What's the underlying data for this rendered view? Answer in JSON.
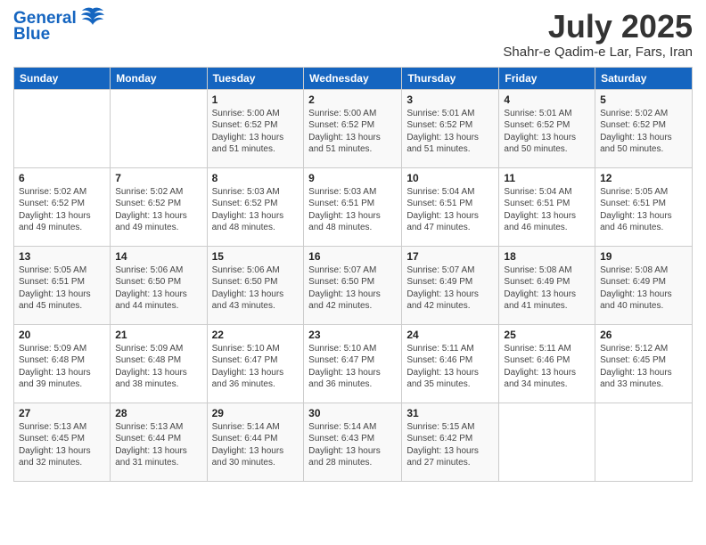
{
  "header": {
    "logo_line1": "General",
    "logo_line2": "Blue",
    "month": "July 2025",
    "location": "Shahr-e Qadim-e Lar, Fars, Iran"
  },
  "weekdays": [
    "Sunday",
    "Monday",
    "Tuesday",
    "Wednesday",
    "Thursday",
    "Friday",
    "Saturday"
  ],
  "weeks": [
    [
      {
        "day": "",
        "info": ""
      },
      {
        "day": "",
        "info": ""
      },
      {
        "day": "1",
        "info": "Sunrise: 5:00 AM\nSunset: 6:52 PM\nDaylight: 13 hours\nand 51 minutes."
      },
      {
        "day": "2",
        "info": "Sunrise: 5:00 AM\nSunset: 6:52 PM\nDaylight: 13 hours\nand 51 minutes."
      },
      {
        "day": "3",
        "info": "Sunrise: 5:01 AM\nSunset: 6:52 PM\nDaylight: 13 hours\nand 51 minutes."
      },
      {
        "day": "4",
        "info": "Sunrise: 5:01 AM\nSunset: 6:52 PM\nDaylight: 13 hours\nand 50 minutes."
      },
      {
        "day": "5",
        "info": "Sunrise: 5:02 AM\nSunset: 6:52 PM\nDaylight: 13 hours\nand 50 minutes."
      }
    ],
    [
      {
        "day": "6",
        "info": "Sunrise: 5:02 AM\nSunset: 6:52 PM\nDaylight: 13 hours\nand 49 minutes."
      },
      {
        "day": "7",
        "info": "Sunrise: 5:02 AM\nSunset: 6:52 PM\nDaylight: 13 hours\nand 49 minutes."
      },
      {
        "day": "8",
        "info": "Sunrise: 5:03 AM\nSunset: 6:52 PM\nDaylight: 13 hours\nand 48 minutes."
      },
      {
        "day": "9",
        "info": "Sunrise: 5:03 AM\nSunset: 6:51 PM\nDaylight: 13 hours\nand 48 minutes."
      },
      {
        "day": "10",
        "info": "Sunrise: 5:04 AM\nSunset: 6:51 PM\nDaylight: 13 hours\nand 47 minutes."
      },
      {
        "day": "11",
        "info": "Sunrise: 5:04 AM\nSunset: 6:51 PM\nDaylight: 13 hours\nand 46 minutes."
      },
      {
        "day": "12",
        "info": "Sunrise: 5:05 AM\nSunset: 6:51 PM\nDaylight: 13 hours\nand 46 minutes."
      }
    ],
    [
      {
        "day": "13",
        "info": "Sunrise: 5:05 AM\nSunset: 6:51 PM\nDaylight: 13 hours\nand 45 minutes."
      },
      {
        "day": "14",
        "info": "Sunrise: 5:06 AM\nSunset: 6:50 PM\nDaylight: 13 hours\nand 44 minutes."
      },
      {
        "day": "15",
        "info": "Sunrise: 5:06 AM\nSunset: 6:50 PM\nDaylight: 13 hours\nand 43 minutes."
      },
      {
        "day": "16",
        "info": "Sunrise: 5:07 AM\nSunset: 6:50 PM\nDaylight: 13 hours\nand 42 minutes."
      },
      {
        "day": "17",
        "info": "Sunrise: 5:07 AM\nSunset: 6:49 PM\nDaylight: 13 hours\nand 42 minutes."
      },
      {
        "day": "18",
        "info": "Sunrise: 5:08 AM\nSunset: 6:49 PM\nDaylight: 13 hours\nand 41 minutes."
      },
      {
        "day": "19",
        "info": "Sunrise: 5:08 AM\nSunset: 6:49 PM\nDaylight: 13 hours\nand 40 minutes."
      }
    ],
    [
      {
        "day": "20",
        "info": "Sunrise: 5:09 AM\nSunset: 6:48 PM\nDaylight: 13 hours\nand 39 minutes."
      },
      {
        "day": "21",
        "info": "Sunrise: 5:09 AM\nSunset: 6:48 PM\nDaylight: 13 hours\nand 38 minutes."
      },
      {
        "day": "22",
        "info": "Sunrise: 5:10 AM\nSunset: 6:47 PM\nDaylight: 13 hours\nand 36 minutes."
      },
      {
        "day": "23",
        "info": "Sunrise: 5:10 AM\nSunset: 6:47 PM\nDaylight: 13 hours\nand 36 minutes."
      },
      {
        "day": "24",
        "info": "Sunrise: 5:11 AM\nSunset: 6:46 PM\nDaylight: 13 hours\nand 35 minutes."
      },
      {
        "day": "25",
        "info": "Sunrise: 5:11 AM\nSunset: 6:46 PM\nDaylight: 13 hours\nand 34 minutes."
      },
      {
        "day": "26",
        "info": "Sunrise: 5:12 AM\nSunset: 6:45 PM\nDaylight: 13 hours\nand 33 minutes."
      }
    ],
    [
      {
        "day": "27",
        "info": "Sunrise: 5:13 AM\nSunset: 6:45 PM\nDaylight: 13 hours\nand 32 minutes."
      },
      {
        "day": "28",
        "info": "Sunrise: 5:13 AM\nSunset: 6:44 PM\nDaylight: 13 hours\nand 31 minutes."
      },
      {
        "day": "29",
        "info": "Sunrise: 5:14 AM\nSunset: 6:44 PM\nDaylight: 13 hours\nand 30 minutes."
      },
      {
        "day": "30",
        "info": "Sunrise: 5:14 AM\nSunset: 6:43 PM\nDaylight: 13 hours\nand 28 minutes."
      },
      {
        "day": "31",
        "info": "Sunrise: 5:15 AM\nSunset: 6:42 PM\nDaylight: 13 hours\nand 27 minutes."
      },
      {
        "day": "",
        "info": ""
      },
      {
        "day": "",
        "info": ""
      }
    ]
  ]
}
